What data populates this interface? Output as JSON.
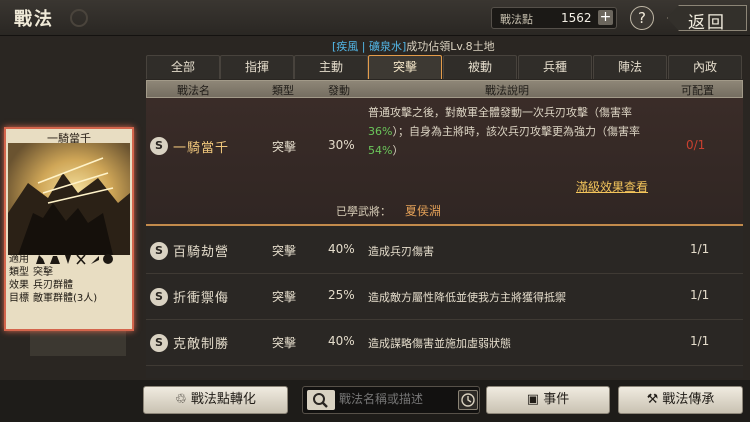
{
  "header": {
    "title": "戰法",
    "points_label": "戰法點",
    "points_value": "1562",
    "points_add": "+",
    "help": "?",
    "back_label": "返回"
  },
  "subtitle": {
    "open": "[",
    "tag1": "疾風",
    "sep": " | ",
    "tag2": "礦泉水",
    "close": "]",
    "text": "成功佔領Lv.8土地"
  },
  "tabs": [
    "全部",
    "指揮",
    "主動",
    "突擊",
    "被動",
    "兵種",
    "陣法",
    "內政"
  ],
  "active_tab": 3,
  "columns": {
    "name": "戰法名",
    "type": "類型",
    "rate": "發動",
    "desc": "戰法說明",
    "config": "可配置"
  },
  "selected": {
    "badge": "S",
    "name": "一騎當千",
    "type": "突擊",
    "rate": "30%",
    "desc_a": "普通攻擊之後，對敵軍全體發動一次兵刃攻擊（傷害率",
    "desc_pct1": "36%",
    "desc_b": "）；自身為主將時，該次兵刃攻擊更為強力（傷害率",
    "desc_pct2": "54%",
    "desc_c": "）",
    "config": "0/1",
    "full_effect_link": "滿級效果查看",
    "learned_label": "已學武將：",
    "learned_general": "夏侯淵"
  },
  "rows": [
    {
      "badge": "S",
      "name": "百騎劫營",
      "type": "突擊",
      "rate": "40%",
      "desc": "造成兵刃傷害",
      "config": "1/1"
    },
    {
      "badge": "S",
      "name": "折衝禦侮",
      "type": "突擊",
      "rate": "25%",
      "desc": "造成敵方屬性降低並使我方主將獲得抵禦",
      "config": "1/1"
    },
    {
      "badge": "S",
      "name": "克敵制勝",
      "type": "突擊",
      "rate": "40%",
      "desc": "造成謀略傷害並施加虛弱狀態",
      "config": "1/1"
    }
  ],
  "card": {
    "title": "一騎當千",
    "apply_label": "適用",
    "type_label": "類型",
    "type_value": "突擊",
    "effect_label": "效果",
    "effect_value": "兵刃群體",
    "target_label": "目標",
    "target_value": "敵軍群體(3人)"
  },
  "bottom": {
    "convert_button": "戰法點轉化",
    "search_placeholder": "戰法名稱或描述",
    "event_button": "事件",
    "inherit_button": "戰法傳承"
  },
  "colors": {
    "accent": "#e49c4a",
    "highlight_green": "#6bc65b",
    "link_gold": "#f2c45b",
    "card_border": "#d4654c"
  }
}
